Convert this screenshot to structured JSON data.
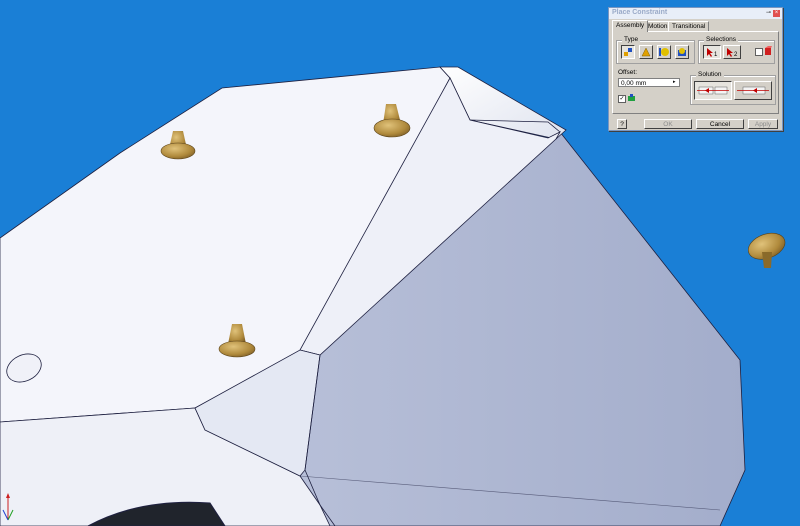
{
  "dialog": {
    "title": "Place Constraint",
    "tabs": [
      {
        "label": "Assembly",
        "active": true
      },
      {
        "label": "Motion",
        "active": false
      },
      {
        "label": "Transitional",
        "active": false
      }
    ],
    "type_group_label": "Type",
    "selections_group_label": "Selections",
    "selection_1": "1",
    "selection_2": "2",
    "offset_label": "Offset:",
    "offset_value": "0,00 mm",
    "solution_group_label": "Solution",
    "help_label": "?",
    "ok_label": "OK",
    "cancel_label": "Cancel",
    "apply_label": "Apply",
    "show_preview_checked": true
  },
  "colors": {
    "background": "#1a7fd6",
    "part_top": "#f4f5fb",
    "part_side": "#a9b3cf",
    "feet": "#b08a3c"
  },
  "icons": [
    "pin-icon",
    "close-icon",
    "mate-constraint-icon",
    "angle-constraint-icon",
    "tangent-constraint-icon",
    "insert-constraint-icon",
    "select-arrow-icon",
    "predict-offset-icon",
    "mate-solution-icon",
    "flush-solution-icon",
    "preview-icon",
    "coordinate-triad-icon"
  ]
}
